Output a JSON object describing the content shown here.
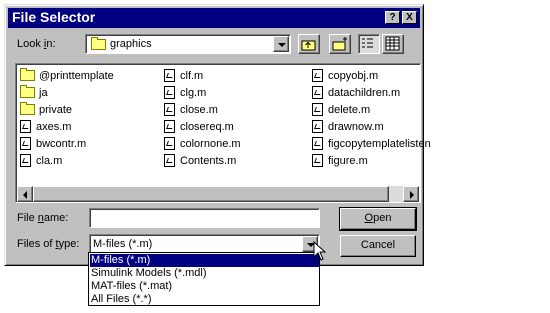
{
  "window": {
    "title": "File Selector",
    "help_glyph": "?",
    "close_glyph": "X"
  },
  "look_in": {
    "label_prefix": "Look ",
    "label_access": "i",
    "label_suffix": "n:",
    "value": "graphics"
  },
  "toolbar": {
    "up_icon": "up-folder-icon",
    "new_folder_icon": "new-folder-icon",
    "list_view_icon": "list-view-icon",
    "details_view_icon": "details-view-icon"
  },
  "files": {
    "columns": [
      [
        {
          "name": "@printtemplate",
          "type": "folder"
        },
        {
          "name": "ja",
          "type": "folder"
        },
        {
          "name": "private",
          "type": "folder"
        },
        {
          "name": "axes.m",
          "type": "mfile"
        },
        {
          "name": "bwcontr.m",
          "type": "mfile"
        },
        {
          "name": "cla.m",
          "type": "mfile"
        }
      ],
      [
        {
          "name": "clf.m",
          "type": "mfile"
        },
        {
          "name": "clg.m",
          "type": "mfile"
        },
        {
          "name": "close.m",
          "type": "mfile"
        },
        {
          "name": "closereq.m",
          "type": "mfile"
        },
        {
          "name": "colornone.m",
          "type": "mfile"
        },
        {
          "name": "Contents.m",
          "type": "mfile"
        }
      ],
      [
        {
          "name": "copyobj.m",
          "type": "mfile"
        },
        {
          "name": "datachildren.m",
          "type": "mfile"
        },
        {
          "name": "delete.m",
          "type": "mfile"
        },
        {
          "name": "drawnow.m",
          "type": "mfile"
        },
        {
          "name": "figcopytemplatelisten",
          "type": "mfile"
        },
        {
          "name": "figure.m",
          "type": "mfile"
        }
      ]
    ]
  },
  "file_name": {
    "label_prefix": "File ",
    "label_access": "n",
    "label_suffix": "ame:",
    "value": ""
  },
  "file_type": {
    "label_prefix": "Files of ",
    "label_access": "t",
    "label_suffix": "ype:",
    "value": "M-files (*.m)",
    "options": [
      "M-files (*.m)",
      "Simulink Models (*.mdl)",
      "MAT-files (*.mat)",
      "All Files (*.*)"
    ],
    "selected_index": 0
  },
  "buttons": {
    "open_access": "O",
    "open_rest": "pen",
    "cancel": "Cancel"
  },
  "colors": {
    "titlebar": "#000080",
    "face": "#c0c0c0",
    "selection": "#000080"
  }
}
